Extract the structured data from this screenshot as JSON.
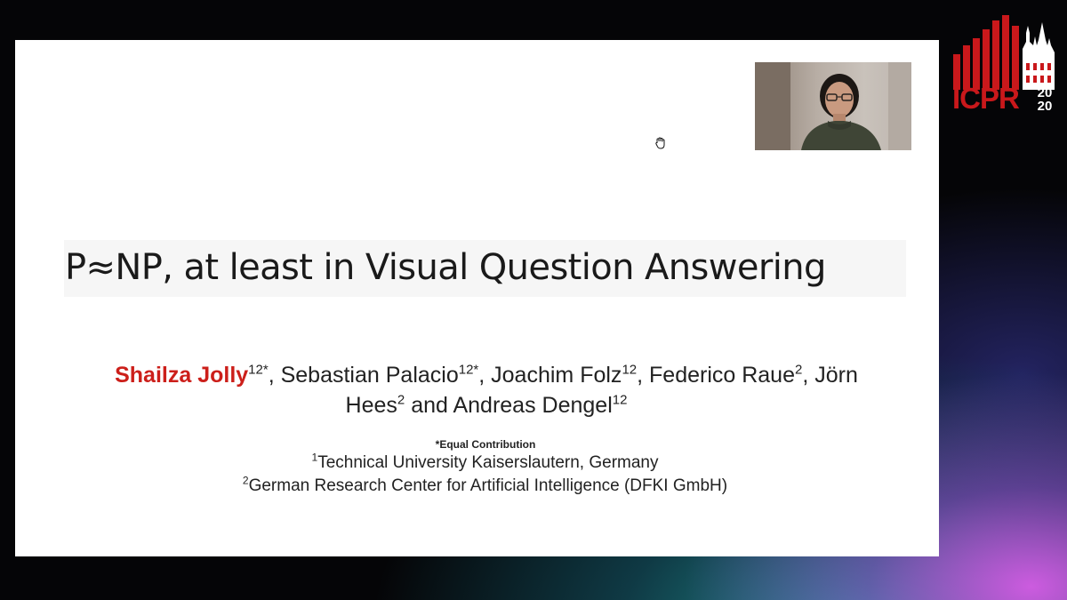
{
  "slide": {
    "title": "P≈NP, at least in Visual Question Answering",
    "authors_line1": {
      "lead_author": "Shailza Jolly",
      "lead_sup": "12*",
      "a2": ", Sebastian Palacio",
      "a2_sup": "12*",
      "a3": ", Joachim Folz",
      "a3_sup": "12",
      "a4": ", Federico Raue",
      "a4_sup": "2",
      "a5": ", Jörn"
    },
    "authors_line2": {
      "a5_rest": "Hees",
      "a5_sup": "2",
      "a6": " and Andreas Dengel",
      "a6_sup": "12"
    },
    "equal_contribution": "*Equal Contribution",
    "affiliations": [
      {
        "sup": "1",
        "text": "Technical University Kaiserslautern, Germany"
      },
      {
        "sup": "2",
        "text": "German Research Center for Artificial Intelligence (DFKI GmbH)"
      }
    ]
  },
  "conference_logo": {
    "text": "ICPR",
    "year_top": "20",
    "year_bottom": "20",
    "color": "#c9181b"
  },
  "icons": {
    "cursor": "hand-grab-cursor-icon",
    "webcam": "presenter-webcam"
  }
}
